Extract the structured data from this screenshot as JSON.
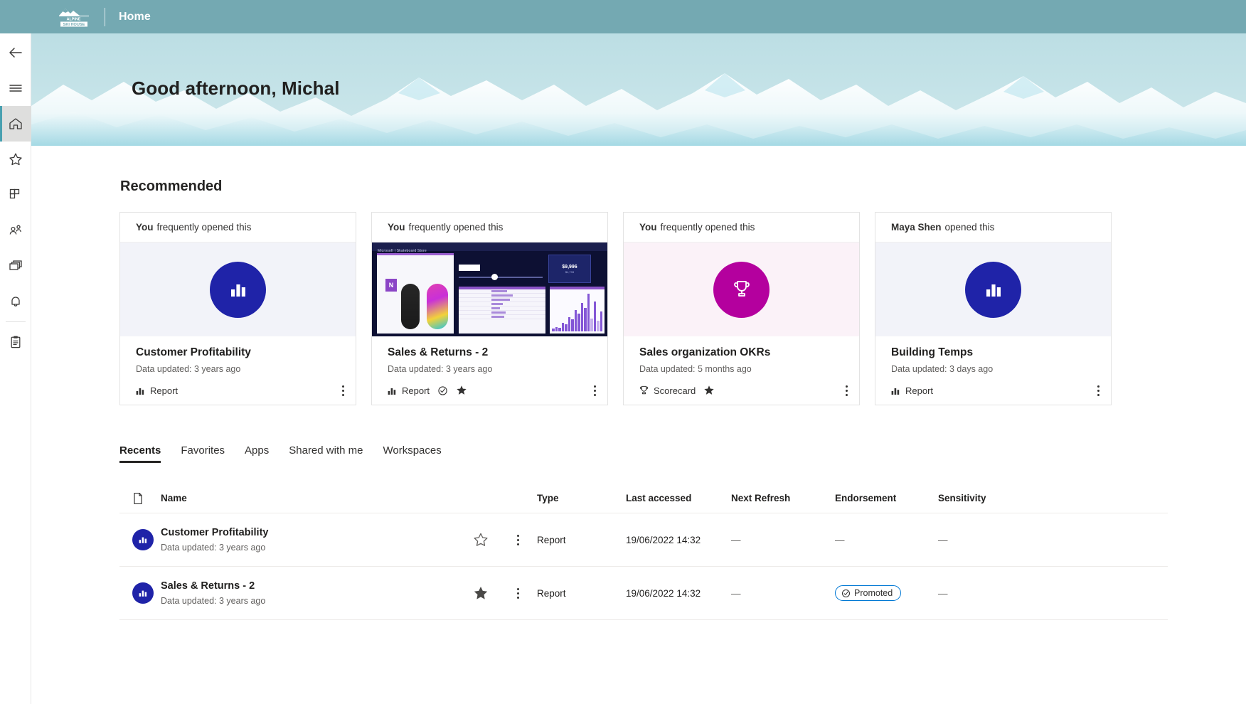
{
  "topbar": {
    "brand_line1": "ALPINE",
    "brand_line2": "SKI HOUSE",
    "title": "Home"
  },
  "rail": {
    "items": [
      {
        "name": "back-arrow",
        "label": "Back"
      },
      {
        "name": "hamburger",
        "label": "Navigation"
      },
      {
        "name": "home",
        "label": "Home"
      },
      {
        "name": "favorites-star",
        "label": "Favorites"
      },
      {
        "name": "apps-grid",
        "label": "Apps"
      },
      {
        "name": "shared-people",
        "label": "Shared with me"
      },
      {
        "name": "workspaces-stack",
        "label": "Workspaces"
      },
      {
        "name": "bell",
        "label": "Notifications"
      },
      {
        "name": "clipboard",
        "label": "Metrics"
      }
    ]
  },
  "hero": {
    "greeting": "Good afternoon, Michal"
  },
  "recommended": {
    "title": "Recommended",
    "cards": [
      {
        "reason_actor": "You",
        "reason_text": "frequently opened this",
        "thumb": "report-icon-blue",
        "name": "Customer Profitability",
        "updated": "Data updated: 3 years ago",
        "type": "Report",
        "type_icon": "report-icon",
        "favorite": false,
        "endorsed": false
      },
      {
        "reason_actor": "You",
        "reason_text": "frequently opened this",
        "thumb": "report-preview",
        "preview": {
          "header": "Microsoft  |  Skateboard Store",
          "panel_title": "What If...",
          "panel_sub": "How Can I Increase Our Return Rate By...",
          "input_value": "25",
          "kpi_label": "Net Sales (Forecast)",
          "kpi_value": "$9,996",
          "kpi_delta": "$4,733",
          "kpi_sub": "Profit Increase",
          "table_title": "Net Sales vs \"What If\" Analysis",
          "chart_title": "\"What If\" Analysis Forecast"
        },
        "name": "Sales & Returns  - 2",
        "updated": "Data updated: 3 years ago",
        "type": "Report",
        "type_icon": "report-icon",
        "favorite": true,
        "endorsed": true
      },
      {
        "reason_actor": "You",
        "reason_text": "frequently opened this",
        "thumb": "trophy-icon-magenta",
        "name": "Sales organization OKRs",
        "updated": "Data updated: 5 months ago",
        "type": "Scorecard",
        "type_icon": "scorecard-icon",
        "favorite": true,
        "endorsed": false
      },
      {
        "reason_actor": "Maya Shen",
        "reason_text": "opened this",
        "thumb": "report-icon-blue",
        "name": "Building Temps",
        "updated": "Data updated: 3 days ago",
        "type": "Report",
        "type_icon": "report-icon",
        "favorite": false,
        "endorsed": false
      }
    ]
  },
  "tabs": [
    {
      "label": "Recents",
      "active": true
    },
    {
      "label": "Favorites",
      "active": false
    },
    {
      "label": "Apps",
      "active": false
    },
    {
      "label": "Shared with me",
      "active": false
    },
    {
      "label": "Workspaces",
      "active": false
    }
  ],
  "table": {
    "headers": {
      "icon": "",
      "name": "Name",
      "type": "Type",
      "last_accessed": "Last accessed",
      "next_refresh": "Next Refresh",
      "endorsement": "Endorsement",
      "sensitivity": "Sensitivity"
    },
    "rows": [
      {
        "icon": "report-icon",
        "name": "Customer Profitability",
        "sub": "Data updated: 3 years ago",
        "favorite": false,
        "type": "Report",
        "last_accessed": "19/06/2022 14:32",
        "next_refresh": "—",
        "endorsement": "—",
        "sensitivity": "—"
      },
      {
        "icon": "report-icon",
        "name": "Sales & Returns  - 2",
        "sub": "Data updated: 3 years ago",
        "favorite": true,
        "type": "Report",
        "last_accessed": "19/06/2022 14:32",
        "next_refresh": "—",
        "endorsement": "Promoted",
        "sensitivity": "—"
      }
    ]
  },
  "colors": {
    "topbar": "#74a9b2",
    "hero_sky": "#c3e2e7",
    "report_blue": "#1f23a8",
    "scorecard_magenta": "#b4009e",
    "accent_teal": "#49a0b0",
    "promoted_border": "#0078d4"
  }
}
